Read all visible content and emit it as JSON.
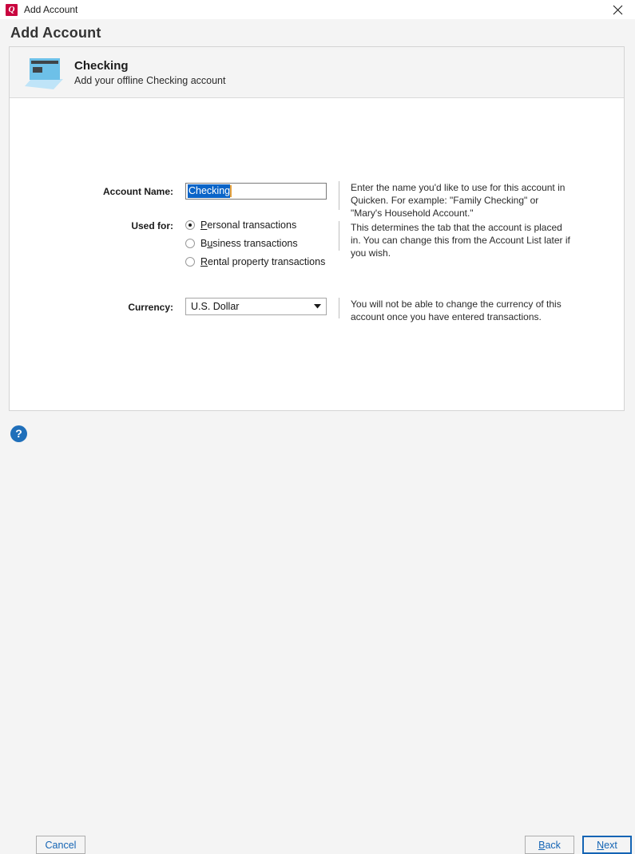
{
  "window": {
    "title": "Add Account",
    "logo_icon": "quicken-q-logo",
    "logo_letter": "Q",
    "close_icon": "close-icon"
  },
  "dialog": {
    "heading": "Add Account"
  },
  "panel": {
    "icon": "credit-card-icon",
    "title": "Checking",
    "subtitle": "Add your offline Checking account"
  },
  "form": {
    "account_name": {
      "label": "Account Name:",
      "value": "Checking",
      "selected": true,
      "help": "Enter the name you'd like to use for this account in Quicken. For example: \"Family Checking\" or \"Mary's Household Account.\""
    },
    "used_for": {
      "label": "Used for:",
      "options": [
        {
          "label": "Personal transactions",
          "mnemonic": "P",
          "rest": "ersonal transactions",
          "checked": true
        },
        {
          "label": "Business transactions",
          "mnemonic": "u",
          "prefix": "B",
          "rest": "siness transactions",
          "checked": false
        },
        {
          "label": "Rental property transactions",
          "mnemonic": "R",
          "rest": "ental property transactions",
          "checked": false
        }
      ],
      "help": "This determines the tab that the account is placed in. You can change this from the Account List later if you wish."
    },
    "currency": {
      "label": "Currency:",
      "value": "U.S. Dollar",
      "dropdown_icon": "chevron-down-icon",
      "help": "You will not be able to change the currency of this account once you have entered transactions."
    }
  },
  "footer": {
    "help_icon": "question-mark-icon",
    "help_glyph": "?",
    "cancel_label": "Cancel",
    "back": {
      "mnemonic": "B",
      "rest": "ack"
    },
    "next": {
      "mnemonic": "N",
      "rest": "ext"
    }
  },
  "colors": {
    "brand_red": "#c9053f",
    "link_blue": "#1464b4",
    "selection_blue": "#0a64c8",
    "card_blue": "#6dc0e8",
    "card_stripe": "#3f4448",
    "panel_gray": "#f4f4f4"
  }
}
